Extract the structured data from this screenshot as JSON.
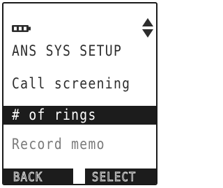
{
  "screen": {
    "status": {
      "battery_icon": "battery-full-icon",
      "scroll_icon": "scroll-up-down-icon"
    },
    "title": "ANS SYS SETUP",
    "menu_items": [
      {
        "label": "Call screening",
        "selected": false
      },
      {
        "label": "# of rings",
        "selected": true
      },
      {
        "label": "Record memo",
        "selected": false
      }
    ],
    "softkeys": {
      "left": "BACK",
      "right": "SELECT"
    },
    "colors": {
      "text": "#2d2d2d",
      "highlight": "#1c1c1c",
      "dimmed_text": "#7a7a7a",
      "background": "#ffffff"
    }
  }
}
